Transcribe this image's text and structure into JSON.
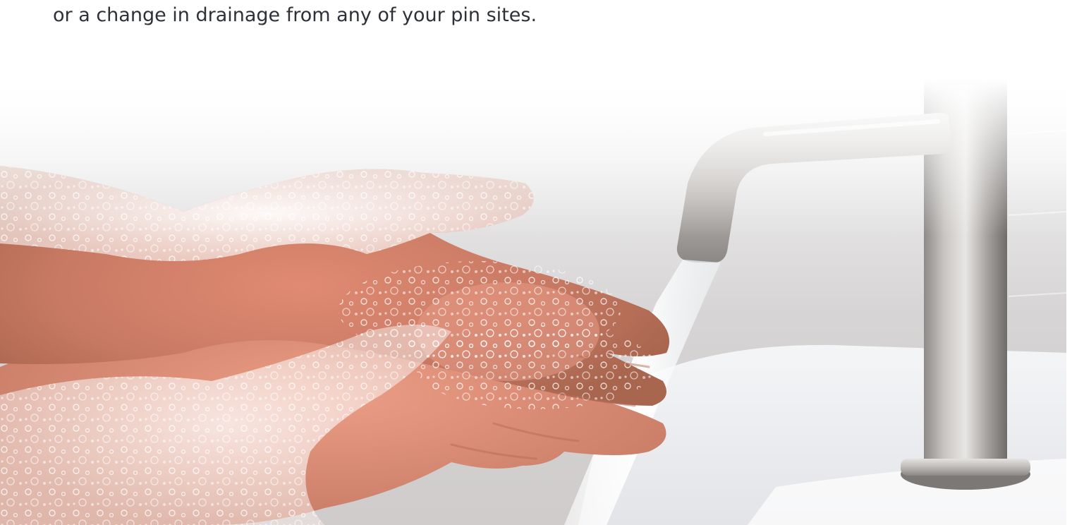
{
  "caption": {
    "text": "or a change in drainage from any of your pin sites."
  },
  "photo": {
    "subject": "hands lathered with soap under a running stainless steel faucet",
    "icon": "photo-hand-washing"
  }
}
